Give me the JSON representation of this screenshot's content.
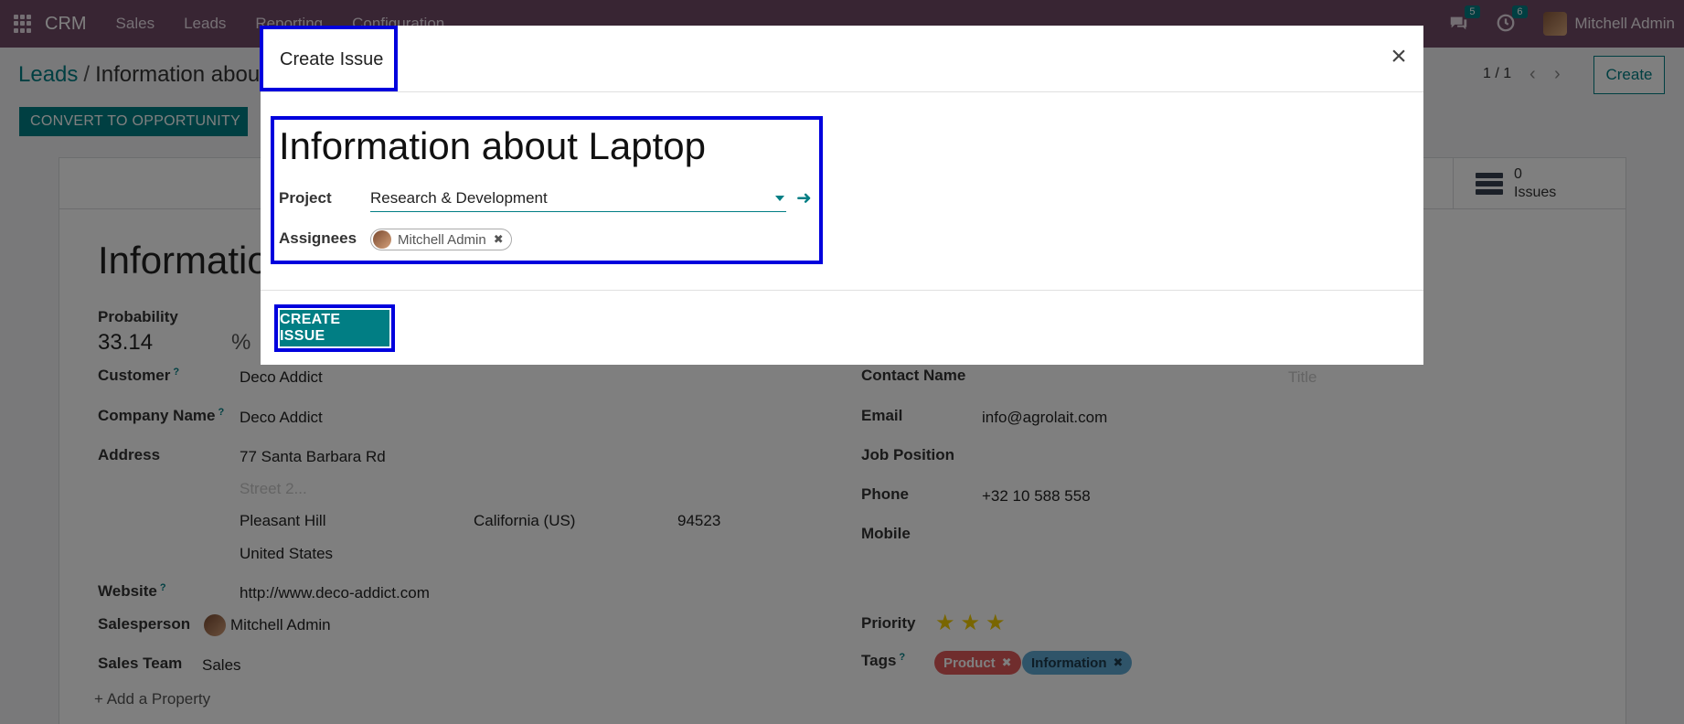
{
  "navbar": {
    "brand": "CRM",
    "menu": [
      "Sales",
      "Leads",
      "Reporting",
      "Configuration"
    ],
    "messages_count": "5",
    "activities_count": "6",
    "user_name": "Mitchell Admin"
  },
  "control_panel": {
    "breadcrumb_parent": "Leads",
    "breadcrumb_current": "Information about Laptop",
    "pager": "1 / 1",
    "create_label": "Create",
    "convert_label": "CONVERT TO OPPORTUNITY"
  },
  "form": {
    "smart_button": {
      "count": "0",
      "label": "Issues"
    },
    "title": "Information about Laptop",
    "probability_label": "Probability",
    "probability_value": "33.14",
    "probability_unit": "%",
    "customer_label": "Customer",
    "customer_value": "Deco Addict",
    "company_label": "Company Name",
    "company_value": "Deco Addict",
    "address_label": "Address",
    "street": "77 Santa Barbara Rd",
    "street2_placeholder": "Street 2...",
    "city": "Pleasant Hill",
    "state": "California (US)",
    "zip": "94523",
    "country": "United States",
    "website_label": "Website",
    "website_value": "http://www.deco-addict.com",
    "salesperson_label": "Salesperson",
    "salesperson_value": "Mitchell Admin",
    "sales_team_label": "Sales Team",
    "sales_team_value": "Sales",
    "add_property": "Add a Property",
    "contact_name_label": "Contact Name",
    "title_placeholder": "Title",
    "email_label": "Email",
    "email_value": "info@agrolait.com",
    "job_position_label": "Job Position",
    "phone_label": "Phone",
    "phone_value": "+32 10 588 558",
    "mobile_label": "Mobile",
    "priority_label": "Priority",
    "priority_stars": 3,
    "tags_label": "Tags",
    "tags": [
      "Product",
      "Information"
    ]
  },
  "modal": {
    "title": "Create Issue",
    "issue_name": "Information about Laptop",
    "project_label": "Project",
    "project_value": "Research & Development",
    "assignees_label": "Assignees",
    "assignee": "Mitchell Admin",
    "create_button": "CREATE ISSUE"
  },
  "colors": {
    "navbar": "#714b67",
    "primary": "#017e84",
    "highlight": "#0000dd",
    "tag_product": "#e05b5b",
    "tag_information": "#5fa8d3",
    "star": "#f3cc00"
  }
}
